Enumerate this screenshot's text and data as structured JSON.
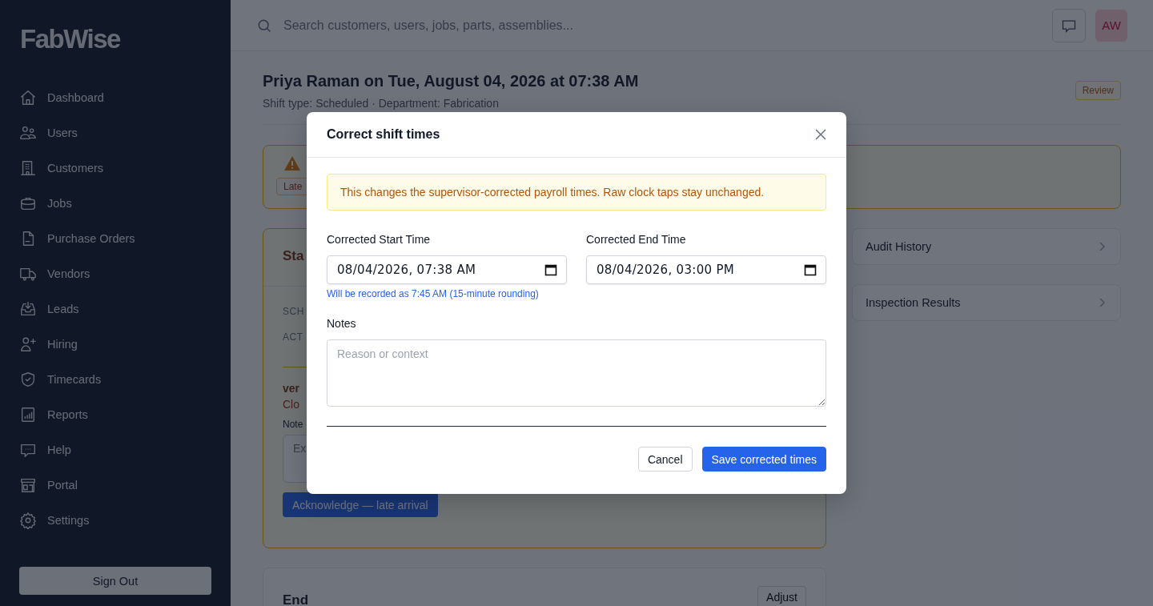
{
  "sidebar": {
    "logo": "FabWise",
    "items": [
      {
        "label": "Dashboard"
      },
      {
        "label": "Users"
      },
      {
        "label": "Customers"
      },
      {
        "label": "Jobs"
      },
      {
        "label": "Purchase Orders"
      },
      {
        "label": "Vendors"
      },
      {
        "label": "Leads"
      },
      {
        "label": "Hiring"
      },
      {
        "label": "Timecards"
      },
      {
        "label": "Reports"
      },
      {
        "label": "Help"
      },
      {
        "label": "Portal"
      },
      {
        "label": "Settings"
      }
    ],
    "sign_out": "Sign Out"
  },
  "topbar": {
    "search_placeholder": "Search customers, users, jobs, parts, assemblies...",
    "avatar": "AW"
  },
  "page": {
    "title": "Priya Raman on Tue, August 04, 2026 at 07:38 AM",
    "subtitle": "Shift type: Scheduled · Department: Fabrication",
    "status_badge": "Review",
    "alert": {
      "badge": "Late"
    },
    "start_card": {
      "title": "Sta",
      "labels": [
        "SCH",
        "ACT"
      ],
      "exception_title": "ver",
      "exception_text": "Clo",
      "note_label": "Note",
      "note_placeholder": "Ex",
      "button": "Acknowledge — late arrival"
    },
    "side_links": [
      {
        "label": "Audit History"
      },
      {
        "label": "Inspection Results"
      }
    ],
    "end_card": {
      "title": "End",
      "button": "Adjust"
    }
  },
  "modal": {
    "title": "Correct shift times",
    "notice": "This changes the supervisor-corrected payroll times. Raw clock taps stay unchanged.",
    "fields": [
      {
        "label": "Corrected Start Time",
        "value": "08/04/2026, 07:38 AM",
        "hint": "Will be recorded as 7:45 AM (15-minute rounding)"
      },
      {
        "label": "Corrected End Time",
        "value": "08/04/2026, 03:00 PM"
      }
    ],
    "notes": {
      "label": "Notes",
      "placeholder": "Reason or context"
    },
    "buttons": [
      {
        "label": "Cancel",
        "kind": "secondary"
      },
      {
        "label": "Save corrected times",
        "kind": "primary"
      }
    ]
  }
}
